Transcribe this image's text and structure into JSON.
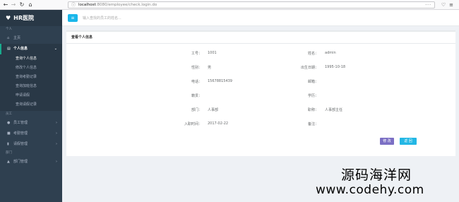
{
  "browser": {
    "url_host": "localhost",
    "url_rest": ":8080/employee/check.login.do",
    "url_menu": "···"
  },
  "sidebar": {
    "brand": "HR医院",
    "section_personal": "个人",
    "home": "主页",
    "personal_info": "个人信息",
    "sub_items": [
      {
        "label": "查询个人信息",
        "active": true
      },
      {
        "label": "修改个人信息",
        "active": false
      },
      {
        "label": "查询考勤记录",
        "active": false
      },
      {
        "label": "查询加班信息",
        "active": false
      },
      {
        "label": "申请请假",
        "active": false
      },
      {
        "label": "查询请假记录",
        "active": false
      }
    ],
    "section_staff": "员工",
    "staff_manage": "员工管理",
    "attendance_manage": "考勤管理",
    "leave_manage": "请假管理",
    "section_dept": "部门",
    "dept_manage": "部门管理"
  },
  "header": {
    "search_placeholder": "输入查找的员工的姓名..."
  },
  "panel": {
    "title": "查看个人信息",
    "fields": {
      "emp_no_label": "工号：",
      "emp_no": "1001",
      "name_label": "姓名：",
      "name": "admin",
      "gender_label": "性别：",
      "gender": "男",
      "birth_label": "出生日期：",
      "birth": "1995-10-18",
      "phone_label": "电话：",
      "phone": "15678815439",
      "email_label": "邮箱：",
      "email": "",
      "origin_label": "籍贯：",
      "origin": "",
      "edu_label": "学历：",
      "edu": "",
      "dept_label": "部门：",
      "dept": "人事部",
      "position_label": "职称：",
      "position": "人事部主任",
      "hire_label": "入职时间：",
      "hire": "2017-02-22",
      "remark_label": "备注：",
      "remark": ""
    },
    "edit_label": "修 改",
    "back_label": "返 回"
  },
  "watermark": {
    "line1": "源码海洋网",
    "line2": "www.codehy.com"
  }
}
